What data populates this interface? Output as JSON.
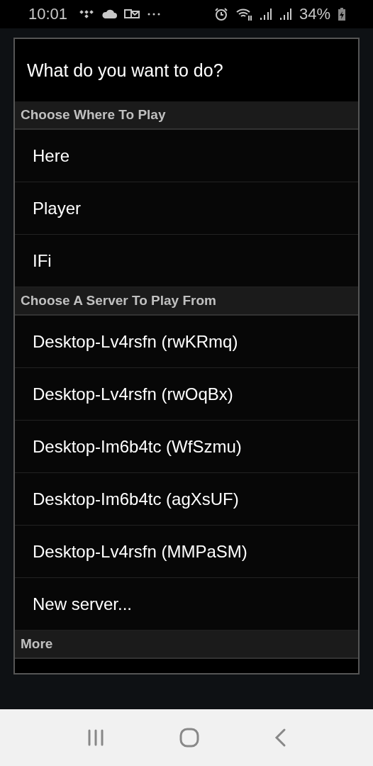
{
  "status_bar": {
    "time": "10:01",
    "battery": "34%"
  },
  "dialog": {
    "title": "What do you want to do?",
    "sections": [
      {
        "header": "Choose Where To Play",
        "items": [
          "Here",
          "Player",
          "IFi"
        ]
      },
      {
        "header": "Choose A Server To Play From",
        "items": [
          "Desktop-Lv4rsfn (rwKRmq)",
          "Desktop-Lv4rsfn (rwOqBx)",
          "Desktop-Im6b4tc (WfSzmu)",
          "Desktop-Im6b4tc (agXsUF)",
          "Desktop-Lv4rsfn (MMPaSM)",
          "New server..."
        ]
      },
      {
        "header": "More"
      }
    ]
  }
}
